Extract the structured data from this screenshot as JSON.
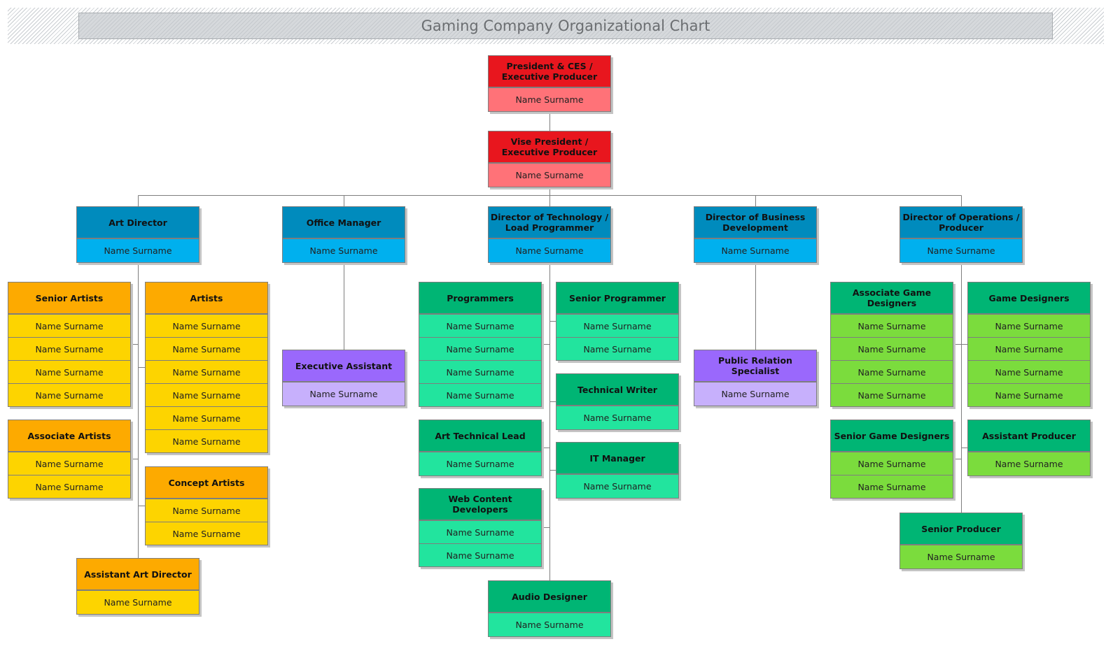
{
  "title": "Gaming Company Organizational Chart",
  "colors": {
    "red": {
      "header": "#e8161e",
      "body": "#ff7278"
    },
    "blue": {
      "header": "#008bbd",
      "body": "#00b0ee"
    },
    "orange": {
      "header": "#fdaa00",
      "body": "#fdd400"
    },
    "purple": {
      "header": "#9a68fc",
      "body": "#c7b0fc"
    },
    "green": {
      "header": "#00b574",
      "body": "#22e49e"
    },
    "lime": {
      "header": "#00b574",
      "body": "#7bdc3d"
    },
    "line": "#7e7e7e"
  },
  "nodes": [
    {
      "id": "president",
      "title": "President & CES / Executive Producer",
      "scheme": "red",
      "members": [
        "Name Surname"
      ]
    },
    {
      "id": "vice-president",
      "title": "Vise President / Executive Producer",
      "scheme": "red",
      "members": [
        "Name Surname"
      ]
    },
    {
      "id": "art-director",
      "title": "Art Director",
      "scheme": "blue",
      "members": [
        "Name Surname"
      ]
    },
    {
      "id": "office-manager",
      "title": "Office Manager",
      "scheme": "blue",
      "members": [
        "Name Surname"
      ]
    },
    {
      "id": "director-technology",
      "title": "Director of Technology / Load Programmer",
      "scheme": "blue",
      "members": [
        "Name Surname"
      ]
    },
    {
      "id": "director-business",
      "title": "Director of Business Development",
      "scheme": "blue",
      "members": [
        "Name Surname"
      ]
    },
    {
      "id": "director-operations",
      "title": "Director of Operations / Producer",
      "scheme": "blue",
      "members": [
        "Name Surname"
      ]
    },
    {
      "id": "senior-artists",
      "title": "Senior Artists",
      "scheme": "orange",
      "members": [
        "Name Surname",
        "Name Surname",
        "Name Surname",
        "Name Surname"
      ]
    },
    {
      "id": "artists",
      "title": "Artists",
      "scheme": "orange",
      "members": [
        "Name Surname",
        "Name Surname",
        "Name Surname",
        "Name Surname",
        "Name Surname",
        "Name Surname"
      ]
    },
    {
      "id": "associate-artists",
      "title": "Associate Artists",
      "scheme": "orange",
      "members": [
        "Name Surname",
        "Name Surname"
      ]
    },
    {
      "id": "concept-artists",
      "title": "Concept Artists",
      "scheme": "orange",
      "members": [
        "Name Surname",
        "Name Surname"
      ]
    },
    {
      "id": "assistant-art-director",
      "title": "Assistant Art Director",
      "scheme": "orange",
      "members": [
        "Name Surname"
      ]
    },
    {
      "id": "executive-assistant",
      "title": "Executive Assistant",
      "scheme": "purple",
      "members": [
        "Name Surname"
      ]
    },
    {
      "id": "programmers",
      "title": "Programmers",
      "scheme": "green",
      "members": [
        "Name Surname",
        "Name Surname",
        "Name Surname",
        "Name Surname"
      ]
    },
    {
      "id": "senior-programmer",
      "title": "Senior Programmer",
      "scheme": "green",
      "members": [
        "Name Surname",
        "Name Surname"
      ]
    },
    {
      "id": "technical-writer",
      "title": "Technical Writer",
      "scheme": "green",
      "members": [
        "Name Surname"
      ]
    },
    {
      "id": "art-technical-lead",
      "title": "Art Technical Lead",
      "scheme": "green",
      "members": [
        "Name Surname"
      ]
    },
    {
      "id": "it-manager",
      "title": "IT Manager",
      "scheme": "green",
      "members": [
        "Name Surname"
      ]
    },
    {
      "id": "web-content-developers",
      "title": "Web Content Developers",
      "scheme": "green",
      "members": [
        "Name Surname",
        "Name Surname"
      ]
    },
    {
      "id": "audio-designer",
      "title": "Audio Designer",
      "scheme": "green",
      "members": [
        "Name Surname"
      ]
    },
    {
      "id": "public-relation-specialist",
      "title": "Public Relation Specialist",
      "scheme": "purple",
      "members": [
        "Name Surname"
      ]
    },
    {
      "id": "associate-game-designers",
      "title": "Associate Game Designers",
      "scheme": "lime",
      "members": [
        "Name Surname",
        "Name Surname",
        "Name Surname",
        "Name Surname"
      ]
    },
    {
      "id": "game-designers",
      "title": "Game Designers",
      "scheme": "lime",
      "members": [
        "Name Surname",
        "Name Surname",
        "Name Surname",
        "Name Surname"
      ]
    },
    {
      "id": "senior-game-designers",
      "title": "Senior Game Designers",
      "scheme": "lime",
      "members": [
        "Name Surname",
        "Name Surname"
      ]
    },
    {
      "id": "assistant-producer",
      "title": "Assistant Producer",
      "scheme": "lime",
      "members": [
        "Name Surname"
      ]
    },
    {
      "id": "senior-producer",
      "title": "Senior Producer",
      "scheme": "lime",
      "members": [
        "Name Surname"
      ]
    }
  ]
}
